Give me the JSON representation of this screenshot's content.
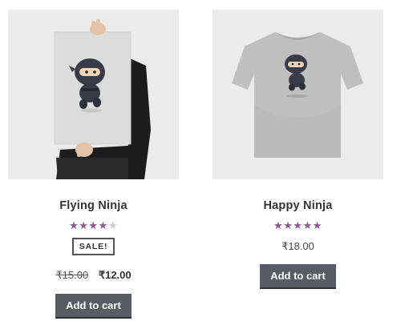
{
  "products": [
    {
      "name": "Flying Ninja",
      "rating": 4,
      "rating_max": 5,
      "stars_text": "★★★★★",
      "sale_label": "SALE!",
      "old_price": "₹15.00",
      "price": "₹12.00",
      "button_label": "Add to cart",
      "image_icon": "poster-ninja-image"
    },
    {
      "name": "Happy Ninja",
      "rating": 5,
      "rating_max": 5,
      "stars_text": "★★★★★",
      "price": "₹18.00",
      "button_label": "Add to cart",
      "image_icon": "tshirt-ninja-image"
    }
  ],
  "colors": {
    "star": "#8e5a91",
    "button_bg": "#5a5c63",
    "thumb_bg": "#ebebeb"
  }
}
